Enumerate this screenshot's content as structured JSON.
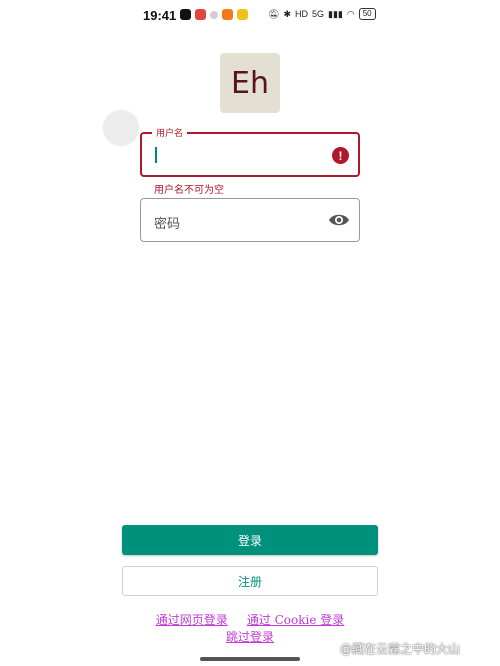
{
  "status_bar": {
    "time": "19:41",
    "app_icons": [
      "tiktok-icon",
      "news-icon",
      "dot-icon",
      "app-orange-icon",
      "app-yellow-icon"
    ],
    "signal_text": "5G",
    "battery": "50"
  },
  "logo": {
    "text": "Eh"
  },
  "username_field": {
    "label": "用户名",
    "value": "",
    "error": "用户名不可为空",
    "error_icon": "!"
  },
  "password_field": {
    "placeholder": "密码"
  },
  "buttons": {
    "login": "登录",
    "register": "注册"
  },
  "links": {
    "web_login": "通过网页登录",
    "cookie_login": "通过 Cookie 登录",
    "skip_login": "跳过登录"
  },
  "watermark": "@藏在云霧之中的大山",
  "colors": {
    "accent": "#00917c",
    "error": "#b0182e",
    "link": "#c03bd6",
    "logo_bg": "#e3e0d3",
    "logo_text": "#5a1418"
  }
}
